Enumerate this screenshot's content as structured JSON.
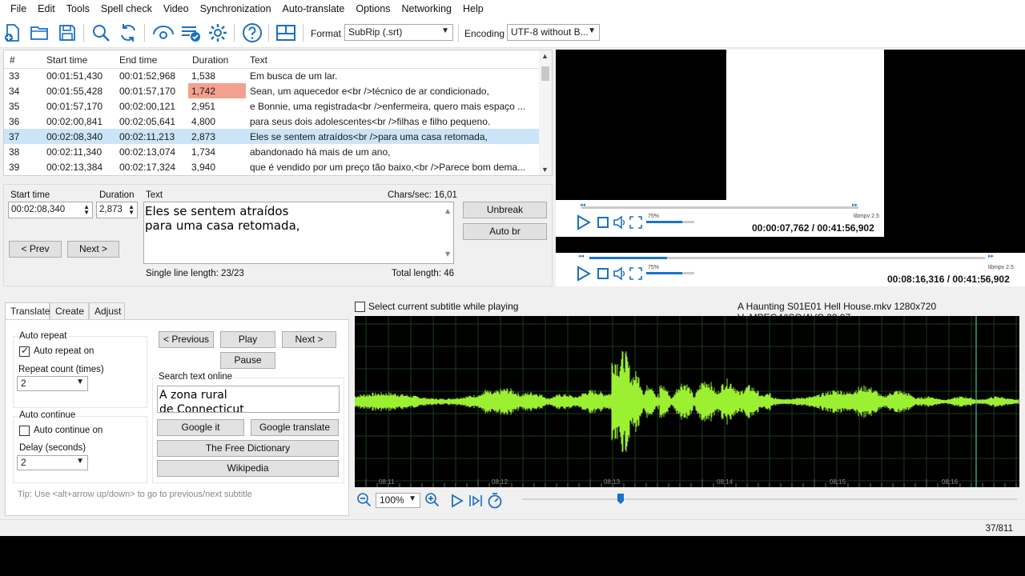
{
  "menu": [
    "File",
    "Edit",
    "Tools",
    "Spell check",
    "Video",
    "Synchronization",
    "Auto-translate",
    "Options",
    "Networking",
    "Help"
  ],
  "toolbar": {
    "icons": [
      "new-file-icon",
      "open-folder-icon",
      "save-icon",
      "find-icon",
      "replace-icon",
      "visual-sync-icon",
      "spell-check-icon",
      "settings-icon",
      "help-icon",
      "layout-icon"
    ],
    "format_label": "Format",
    "format_value": "SubRip (.srt)",
    "encoding_label": "Encoding",
    "encoding_value": "UTF-8 without B..."
  },
  "grid": {
    "headers": [
      "#",
      "Start time",
      "End time",
      "Duration",
      "Text"
    ],
    "rows": [
      {
        "num": "33",
        "start": "00:01:51,430",
        "end": "00:01:52,968",
        "duration": "1,538",
        "text": "Em busca de um lar."
      },
      {
        "num": "34",
        "start": "00:01:55,428",
        "end": "00:01:57,170",
        "duration": "1,742",
        "text": "Sean, um aquecedor e<br />técnico de ar condicionado,"
      },
      {
        "num": "35",
        "start": "00:01:57,170",
        "end": "00:02:00,121",
        "duration": "2,951",
        "text": "e Bonnie, uma registrada<br />enfermeira, quero mais espaço ..."
      },
      {
        "num": "36",
        "start": "00:02:00,841",
        "end": "00:02:05,641",
        "duration": "4,800",
        "text": "para seus dois adolescentes<br />filhas e filho pequeno."
      },
      {
        "num": "37",
        "start": "00:02:08,340",
        "end": "00:02:11,213",
        "duration": "2,873",
        "text": "Eles se sentem atraídos<br />para uma casa retomada,"
      },
      {
        "num": "38",
        "start": "00:02:11,340",
        "end": "00:02:13,074",
        "duration": "1,734",
        "text": "abandonado há mais de um ano,"
      },
      {
        "num": "39",
        "start": "00:02:13,384",
        "end": "00:02:17,324",
        "duration": "3,940",
        "text": "que é vendido por um preço tão baixo,<br />Parece bom dema..."
      }
    ]
  },
  "edit": {
    "start_label": "Start time",
    "start_value": "00:02:08,340",
    "duration_label": "Duration",
    "duration_value": "2,873",
    "text_label": "Text",
    "chars_sec": "Chars/sec: 16,01",
    "line1": "Eles se sentem atraídos",
    "line2": "para uma casa retomada,",
    "single_line": "Single line length: 23/23",
    "total_length": "Total length: 46",
    "prev": "< Prev",
    "next": "Next >",
    "unbreak": "Unbreak",
    "auto_br": "Auto br"
  },
  "video": {
    "player1_time": "00:00:07,762 / 00:41:56,902",
    "player2_time": "00:08:16,316 / 00:41:56,902",
    "volume": "75%",
    "volume_level": 0.75,
    "engine": "libmpv 2.5",
    "player1_progress": 0,
    "player2_progress": 0.197
  },
  "tabs": [
    "Translate",
    "Create",
    "Adjust"
  ],
  "translate": {
    "auto_repeat": "Auto repeat",
    "auto_repeat_on": "Auto repeat on",
    "repeat_count": "Repeat count (times)",
    "repeat_value": "2",
    "auto_continue": "Auto continue",
    "auto_continue_on": "Auto continue on",
    "delay": "Delay (seconds)",
    "delay_value": "2",
    "previous": "< Previous",
    "play": "Play",
    "next": "Next >",
    "pause": "Pause",
    "search_online": "Search text online",
    "search_line1": "A zona rural",
    "search_line2": "de Connecticut",
    "google_it": "Google it",
    "google_translate": "Google translate",
    "free_dictionary": "The Free Dictionary",
    "wikipedia": "Wikipedia",
    "tip": "Tip: Use <alt+arrow up/down> to go to previous/next subtitle"
  },
  "waveform": {
    "select_label": "Select current subtitle while playing",
    "file_info": "A Haunting S01E01 Hell House.mkv 1280x720 V_MPEG4/ISO/AVC 29,97",
    "ticks": [
      "08:11",
      "08:12",
      "08:13",
      "08:14",
      "08:15",
      "08:16"
    ],
    "zoom": "100%",
    "colors": {
      "wave": "#9cf032",
      "grid": "#1c3a1c",
      "cursor": "#3fc0a0"
    }
  },
  "status": {
    "position": "37/811"
  }
}
